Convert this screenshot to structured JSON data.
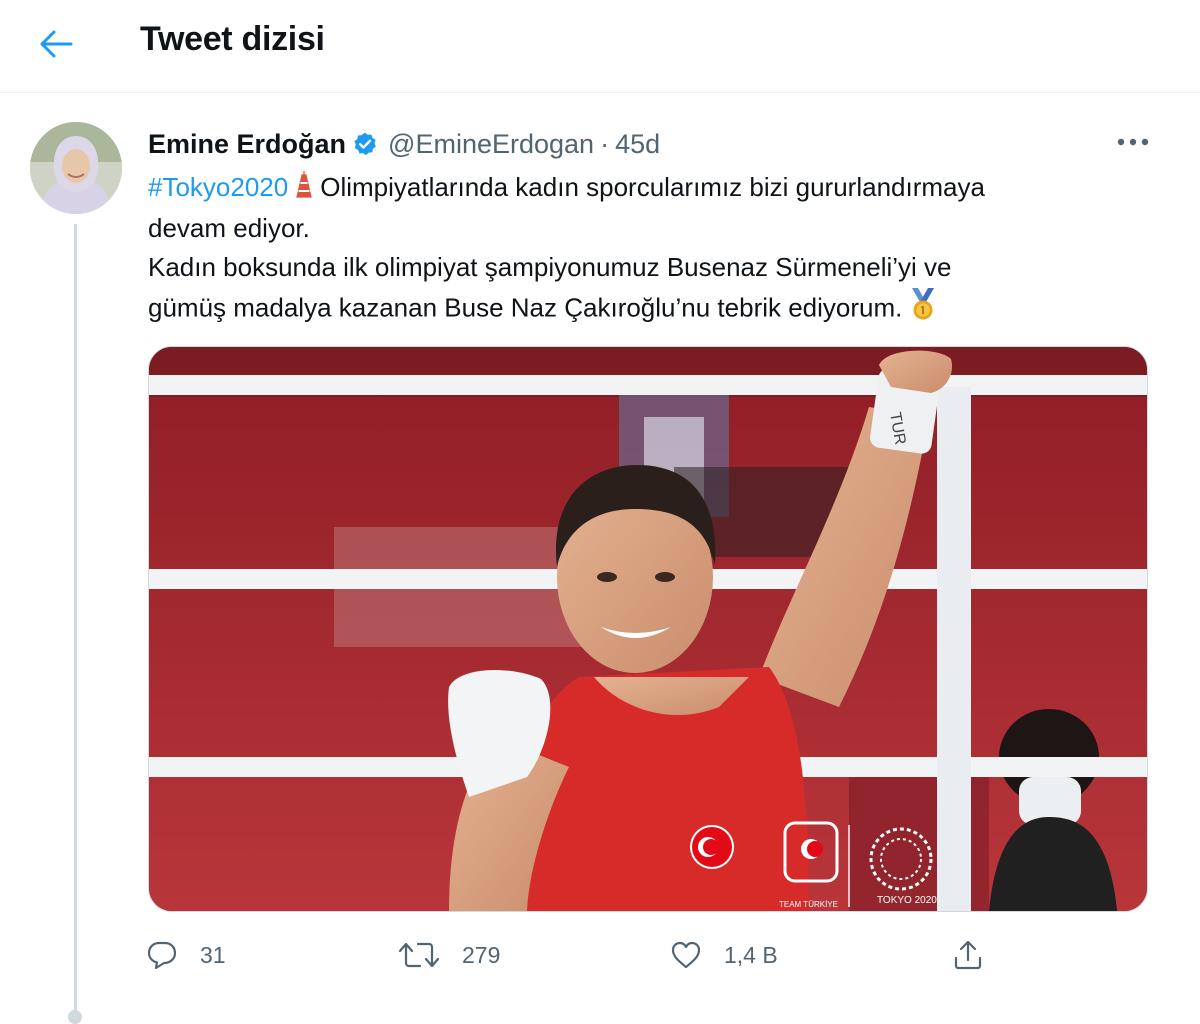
{
  "header": {
    "title": "Tweet dizisi"
  },
  "tweet": {
    "author_name": "Emine Erdoğan",
    "handle": "@EmineErdogan",
    "separator": "·",
    "time": "45d",
    "hashtag": "#Tokyo2020",
    "text_line1_rest": "Olimpiyatlarında kadın sporcularımız bizi gururlandırmaya",
    "text_line2": "devam ediyor.",
    "text_line3": "Kadın boksunda ilk olimpiyat şampiyonumuz Busenaz Sürmeneli’yi ve",
    "text_line4": "gümüş madalya kazanan Buse Naz Çakıroğlu’nu tebrik ediyorum.",
    "media": {
      "boxer_flag_text": "TUR",
      "logo_caption_team": "TEAM TÜRKİYE",
      "logo_caption_games": "TOKYO 2020"
    },
    "actions": {
      "reply_count": "31",
      "retweet_count": "279",
      "like_count": "1,4 B"
    }
  },
  "colors": {
    "accent": "#1d9bf0",
    "secondary_text": "#536471",
    "border": "#cfd9de"
  }
}
